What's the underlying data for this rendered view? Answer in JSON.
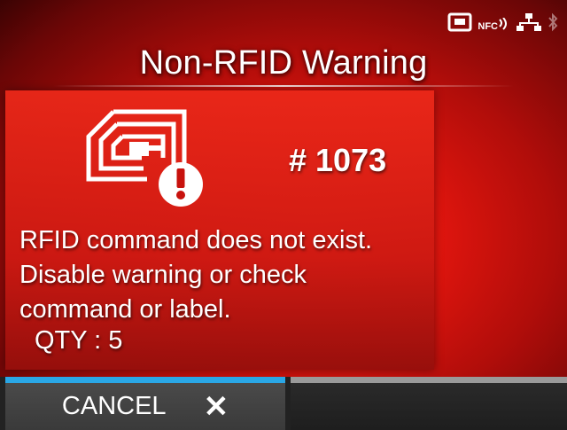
{
  "header": {
    "title": "Non-RFID Warning",
    "status_icons": [
      "card-slot-icon",
      "nfc-icon",
      "network-icon",
      "bluetooth-icon"
    ],
    "nfc_label": "NFC"
  },
  "error": {
    "icon": "rfid-error-icon",
    "code": "# 1073",
    "message_lines": [
      "RFID command does not exist.",
      "Disable warning or check",
      "command or label."
    ],
    "qty": "QTY : 5"
  },
  "softkeys": {
    "cancel_label": "CANCEL",
    "cancel_icon": "close-icon",
    "accent": "#2aa7e6"
  },
  "colors": {
    "background": "#e0150e",
    "panel": "#cd1912"
  }
}
